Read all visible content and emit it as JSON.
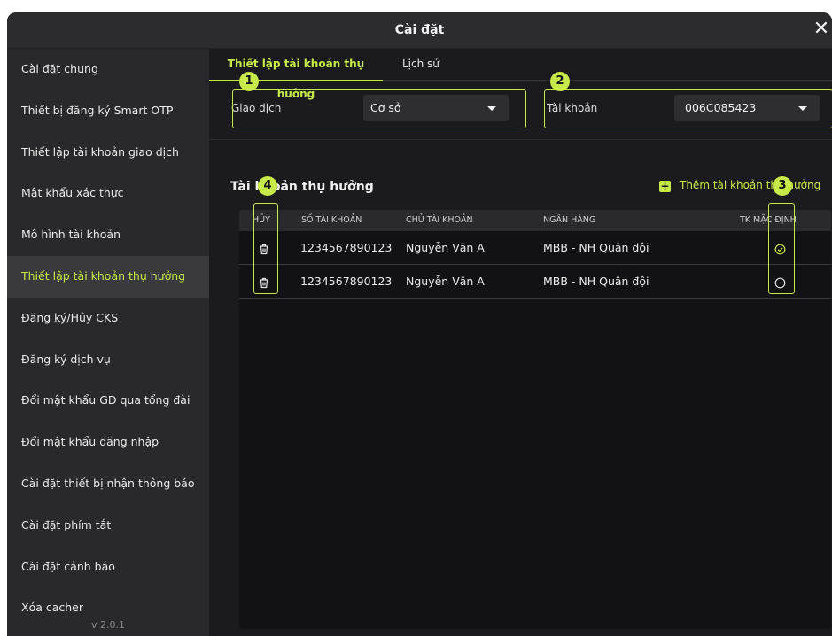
{
  "window": {
    "title": "Cài đặt",
    "close_label": "✕"
  },
  "sidebar": {
    "items": [
      {
        "label": "Cài đặt chung"
      },
      {
        "label": "Thiết bị đăng ký Smart OTP"
      },
      {
        "label": "Thiết lập tài khoản giao dịch"
      },
      {
        "label": "Mật khẩu xác thực"
      },
      {
        "label": "Mô hình tài khoản"
      },
      {
        "label": "Thiết lập tài khoản thụ hưởng",
        "active": true
      },
      {
        "label": "Đăng ký/Hủy CKS"
      },
      {
        "label": "Đăng ký dịch vụ"
      },
      {
        "label": "Đổi mật khẩu GD qua tổng đài"
      },
      {
        "label": "Đổi mật khẩu đăng nhập"
      },
      {
        "label": "Cài đặt thiết bị nhận thông báo"
      },
      {
        "label": "Cài đặt phím tắt"
      },
      {
        "label": "Cài đặt cảnh báo"
      },
      {
        "label": "Xóa cacher"
      }
    ],
    "version": "v 2.0.1"
  },
  "tabs": [
    {
      "label": "Thiết lập tài khoản thụ hưởng",
      "active": true
    },
    {
      "label": "Lịch sử",
      "active": false
    }
  ],
  "filters": {
    "transaction": {
      "label": "Giao dịch",
      "value": "Cơ sở"
    },
    "account": {
      "label": "Tài khoản",
      "value": "006C085423"
    }
  },
  "section": {
    "title": "Tài khoản thụ hưởng",
    "add_button": "Thêm tài khoản thụ hưởng"
  },
  "table": {
    "headers": [
      "HỦY",
      "SỐ TÀI KHOẢN",
      "CHỦ TÀI KHOẢN",
      "NGÂN HÀNG",
      "TK MẶC ĐỊNH"
    ],
    "rows": [
      {
        "account_number": "1234567890123",
        "owner": "Nguyễn Văn A",
        "bank": "MBB - NH Quân đội",
        "is_default": true
      },
      {
        "account_number": "1234567890123",
        "owner": "Nguyễn Văn A",
        "bank": "MBB - NH Quân đội",
        "is_default": false
      }
    ]
  },
  "annotations": {
    "badges": [
      "1",
      "2",
      "3",
      "4"
    ]
  },
  "colors": {
    "accent": "#c8e94a",
    "window_bg": "#1b1b1d",
    "sidebar_bg": "#29292b",
    "sidebar_active_bg": "#3a3a3c",
    "table_bg": "#121214"
  }
}
